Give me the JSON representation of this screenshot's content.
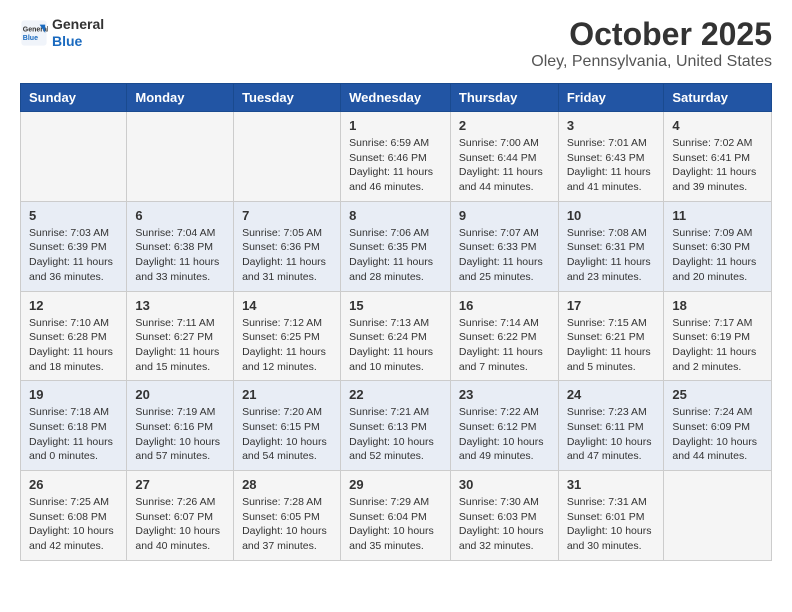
{
  "header": {
    "logo_general": "General",
    "logo_blue": "Blue",
    "title": "October 2025",
    "subtitle": "Oley, Pennsylvania, United States"
  },
  "weekdays": [
    "Sunday",
    "Monday",
    "Tuesday",
    "Wednesday",
    "Thursday",
    "Friday",
    "Saturday"
  ],
  "weeks": [
    [
      {
        "num": "",
        "info": ""
      },
      {
        "num": "",
        "info": ""
      },
      {
        "num": "",
        "info": ""
      },
      {
        "num": "1",
        "info": "Sunrise: 6:59 AM\nSunset: 6:46 PM\nDaylight: 11 hours and 46 minutes."
      },
      {
        "num": "2",
        "info": "Sunrise: 7:00 AM\nSunset: 6:44 PM\nDaylight: 11 hours and 44 minutes."
      },
      {
        "num": "3",
        "info": "Sunrise: 7:01 AM\nSunset: 6:43 PM\nDaylight: 11 hours and 41 minutes."
      },
      {
        "num": "4",
        "info": "Sunrise: 7:02 AM\nSunset: 6:41 PM\nDaylight: 11 hours and 39 minutes."
      }
    ],
    [
      {
        "num": "5",
        "info": "Sunrise: 7:03 AM\nSunset: 6:39 PM\nDaylight: 11 hours and 36 minutes."
      },
      {
        "num": "6",
        "info": "Sunrise: 7:04 AM\nSunset: 6:38 PM\nDaylight: 11 hours and 33 minutes."
      },
      {
        "num": "7",
        "info": "Sunrise: 7:05 AM\nSunset: 6:36 PM\nDaylight: 11 hours and 31 minutes."
      },
      {
        "num": "8",
        "info": "Sunrise: 7:06 AM\nSunset: 6:35 PM\nDaylight: 11 hours and 28 minutes."
      },
      {
        "num": "9",
        "info": "Sunrise: 7:07 AM\nSunset: 6:33 PM\nDaylight: 11 hours and 25 minutes."
      },
      {
        "num": "10",
        "info": "Sunrise: 7:08 AM\nSunset: 6:31 PM\nDaylight: 11 hours and 23 minutes."
      },
      {
        "num": "11",
        "info": "Sunrise: 7:09 AM\nSunset: 6:30 PM\nDaylight: 11 hours and 20 minutes."
      }
    ],
    [
      {
        "num": "12",
        "info": "Sunrise: 7:10 AM\nSunset: 6:28 PM\nDaylight: 11 hours and 18 minutes."
      },
      {
        "num": "13",
        "info": "Sunrise: 7:11 AM\nSunset: 6:27 PM\nDaylight: 11 hours and 15 minutes."
      },
      {
        "num": "14",
        "info": "Sunrise: 7:12 AM\nSunset: 6:25 PM\nDaylight: 11 hours and 12 minutes."
      },
      {
        "num": "15",
        "info": "Sunrise: 7:13 AM\nSunset: 6:24 PM\nDaylight: 11 hours and 10 minutes."
      },
      {
        "num": "16",
        "info": "Sunrise: 7:14 AM\nSunset: 6:22 PM\nDaylight: 11 hours and 7 minutes."
      },
      {
        "num": "17",
        "info": "Sunrise: 7:15 AM\nSunset: 6:21 PM\nDaylight: 11 hours and 5 minutes."
      },
      {
        "num": "18",
        "info": "Sunrise: 7:17 AM\nSunset: 6:19 PM\nDaylight: 11 hours and 2 minutes."
      }
    ],
    [
      {
        "num": "19",
        "info": "Sunrise: 7:18 AM\nSunset: 6:18 PM\nDaylight: 11 hours and 0 minutes."
      },
      {
        "num": "20",
        "info": "Sunrise: 7:19 AM\nSunset: 6:16 PM\nDaylight: 10 hours and 57 minutes."
      },
      {
        "num": "21",
        "info": "Sunrise: 7:20 AM\nSunset: 6:15 PM\nDaylight: 10 hours and 54 minutes."
      },
      {
        "num": "22",
        "info": "Sunrise: 7:21 AM\nSunset: 6:13 PM\nDaylight: 10 hours and 52 minutes."
      },
      {
        "num": "23",
        "info": "Sunrise: 7:22 AM\nSunset: 6:12 PM\nDaylight: 10 hours and 49 minutes."
      },
      {
        "num": "24",
        "info": "Sunrise: 7:23 AM\nSunset: 6:11 PM\nDaylight: 10 hours and 47 minutes."
      },
      {
        "num": "25",
        "info": "Sunrise: 7:24 AM\nSunset: 6:09 PM\nDaylight: 10 hours and 44 minutes."
      }
    ],
    [
      {
        "num": "26",
        "info": "Sunrise: 7:25 AM\nSunset: 6:08 PM\nDaylight: 10 hours and 42 minutes."
      },
      {
        "num": "27",
        "info": "Sunrise: 7:26 AM\nSunset: 6:07 PM\nDaylight: 10 hours and 40 minutes."
      },
      {
        "num": "28",
        "info": "Sunrise: 7:28 AM\nSunset: 6:05 PM\nDaylight: 10 hours and 37 minutes."
      },
      {
        "num": "29",
        "info": "Sunrise: 7:29 AM\nSunset: 6:04 PM\nDaylight: 10 hours and 35 minutes."
      },
      {
        "num": "30",
        "info": "Sunrise: 7:30 AM\nSunset: 6:03 PM\nDaylight: 10 hours and 32 minutes."
      },
      {
        "num": "31",
        "info": "Sunrise: 7:31 AM\nSunset: 6:01 PM\nDaylight: 10 hours and 30 minutes."
      },
      {
        "num": "",
        "info": ""
      }
    ]
  ]
}
